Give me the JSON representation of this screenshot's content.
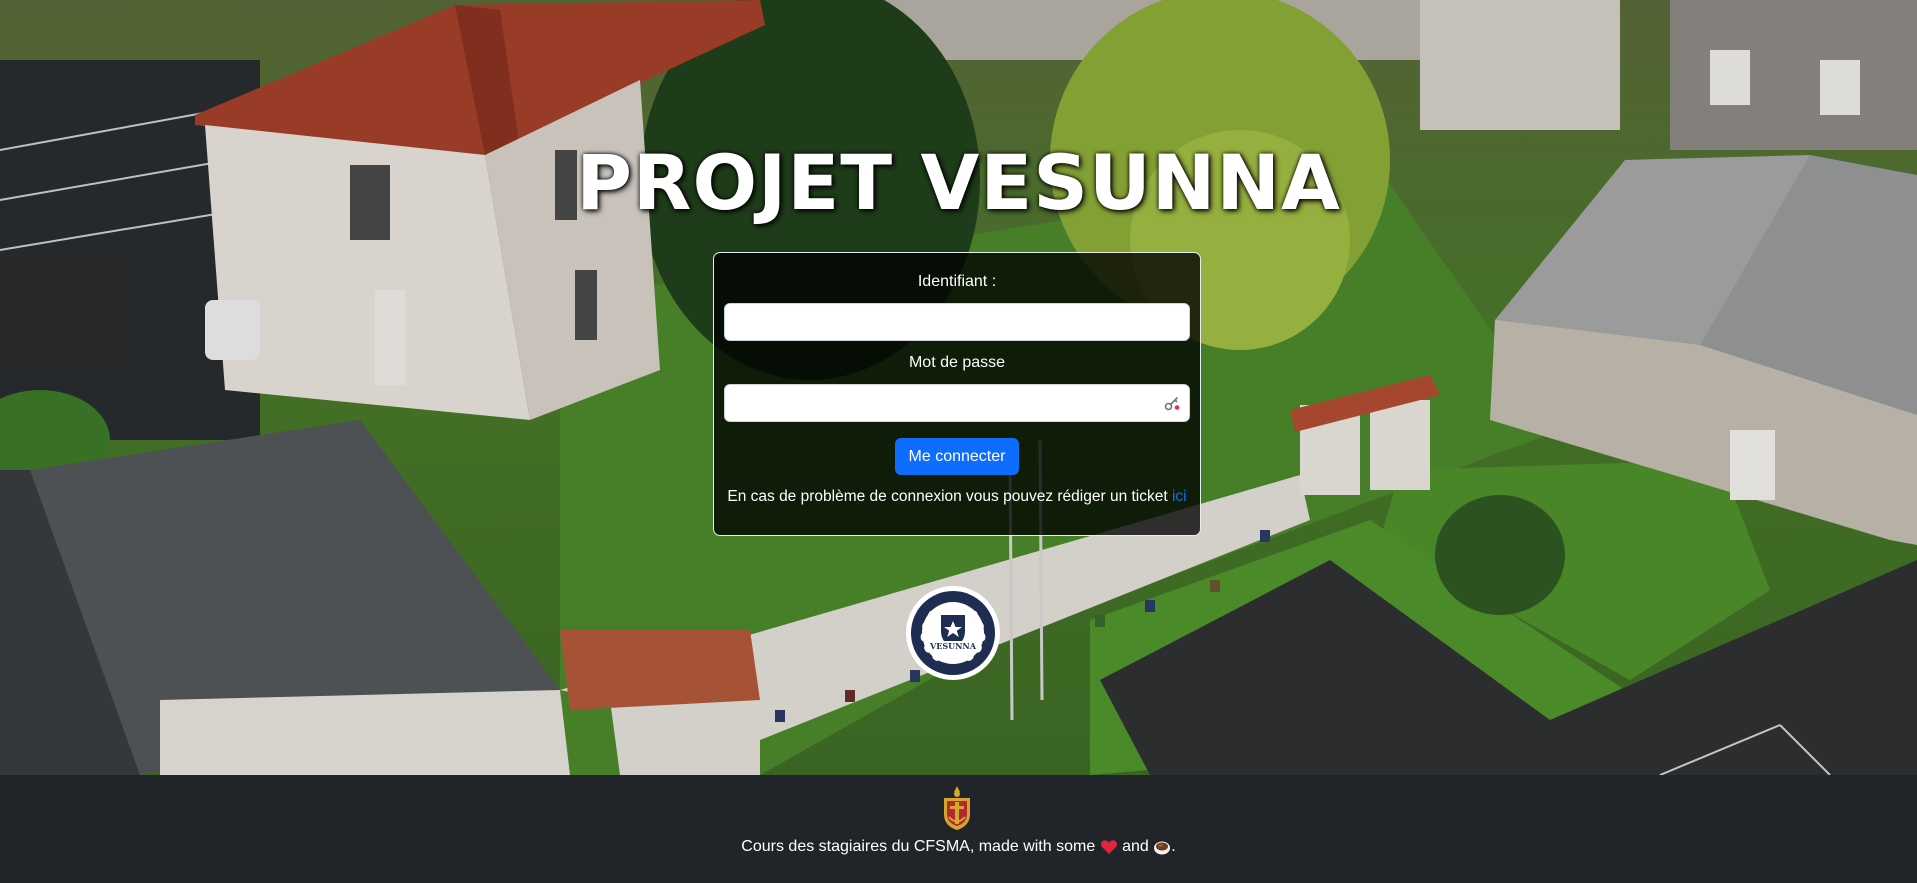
{
  "page": {
    "title": "PROJET VESUNNA"
  },
  "login": {
    "username_label": "Identifiant :",
    "username_value": "",
    "password_label": "Mot de passe",
    "password_value": "",
    "submit_label": "Me connecter",
    "help_text": "En cas de problème de connexion vous pouvez rédiger un ticket ",
    "help_link_text": "ici"
  },
  "emblem": {
    "text": "VESUNNA"
  },
  "footer": {
    "text_before": "Cours des stagiaires du CFSMA, made with some ",
    "text_middle": " and ",
    "text_after": ".",
    "icons": [
      "heart-icon",
      "coffee-icon"
    ]
  },
  "colors": {
    "accent": "#0d6efd",
    "footer_bg": "#212529",
    "card_border": "#e9ecef",
    "heart": "#e0243d"
  }
}
